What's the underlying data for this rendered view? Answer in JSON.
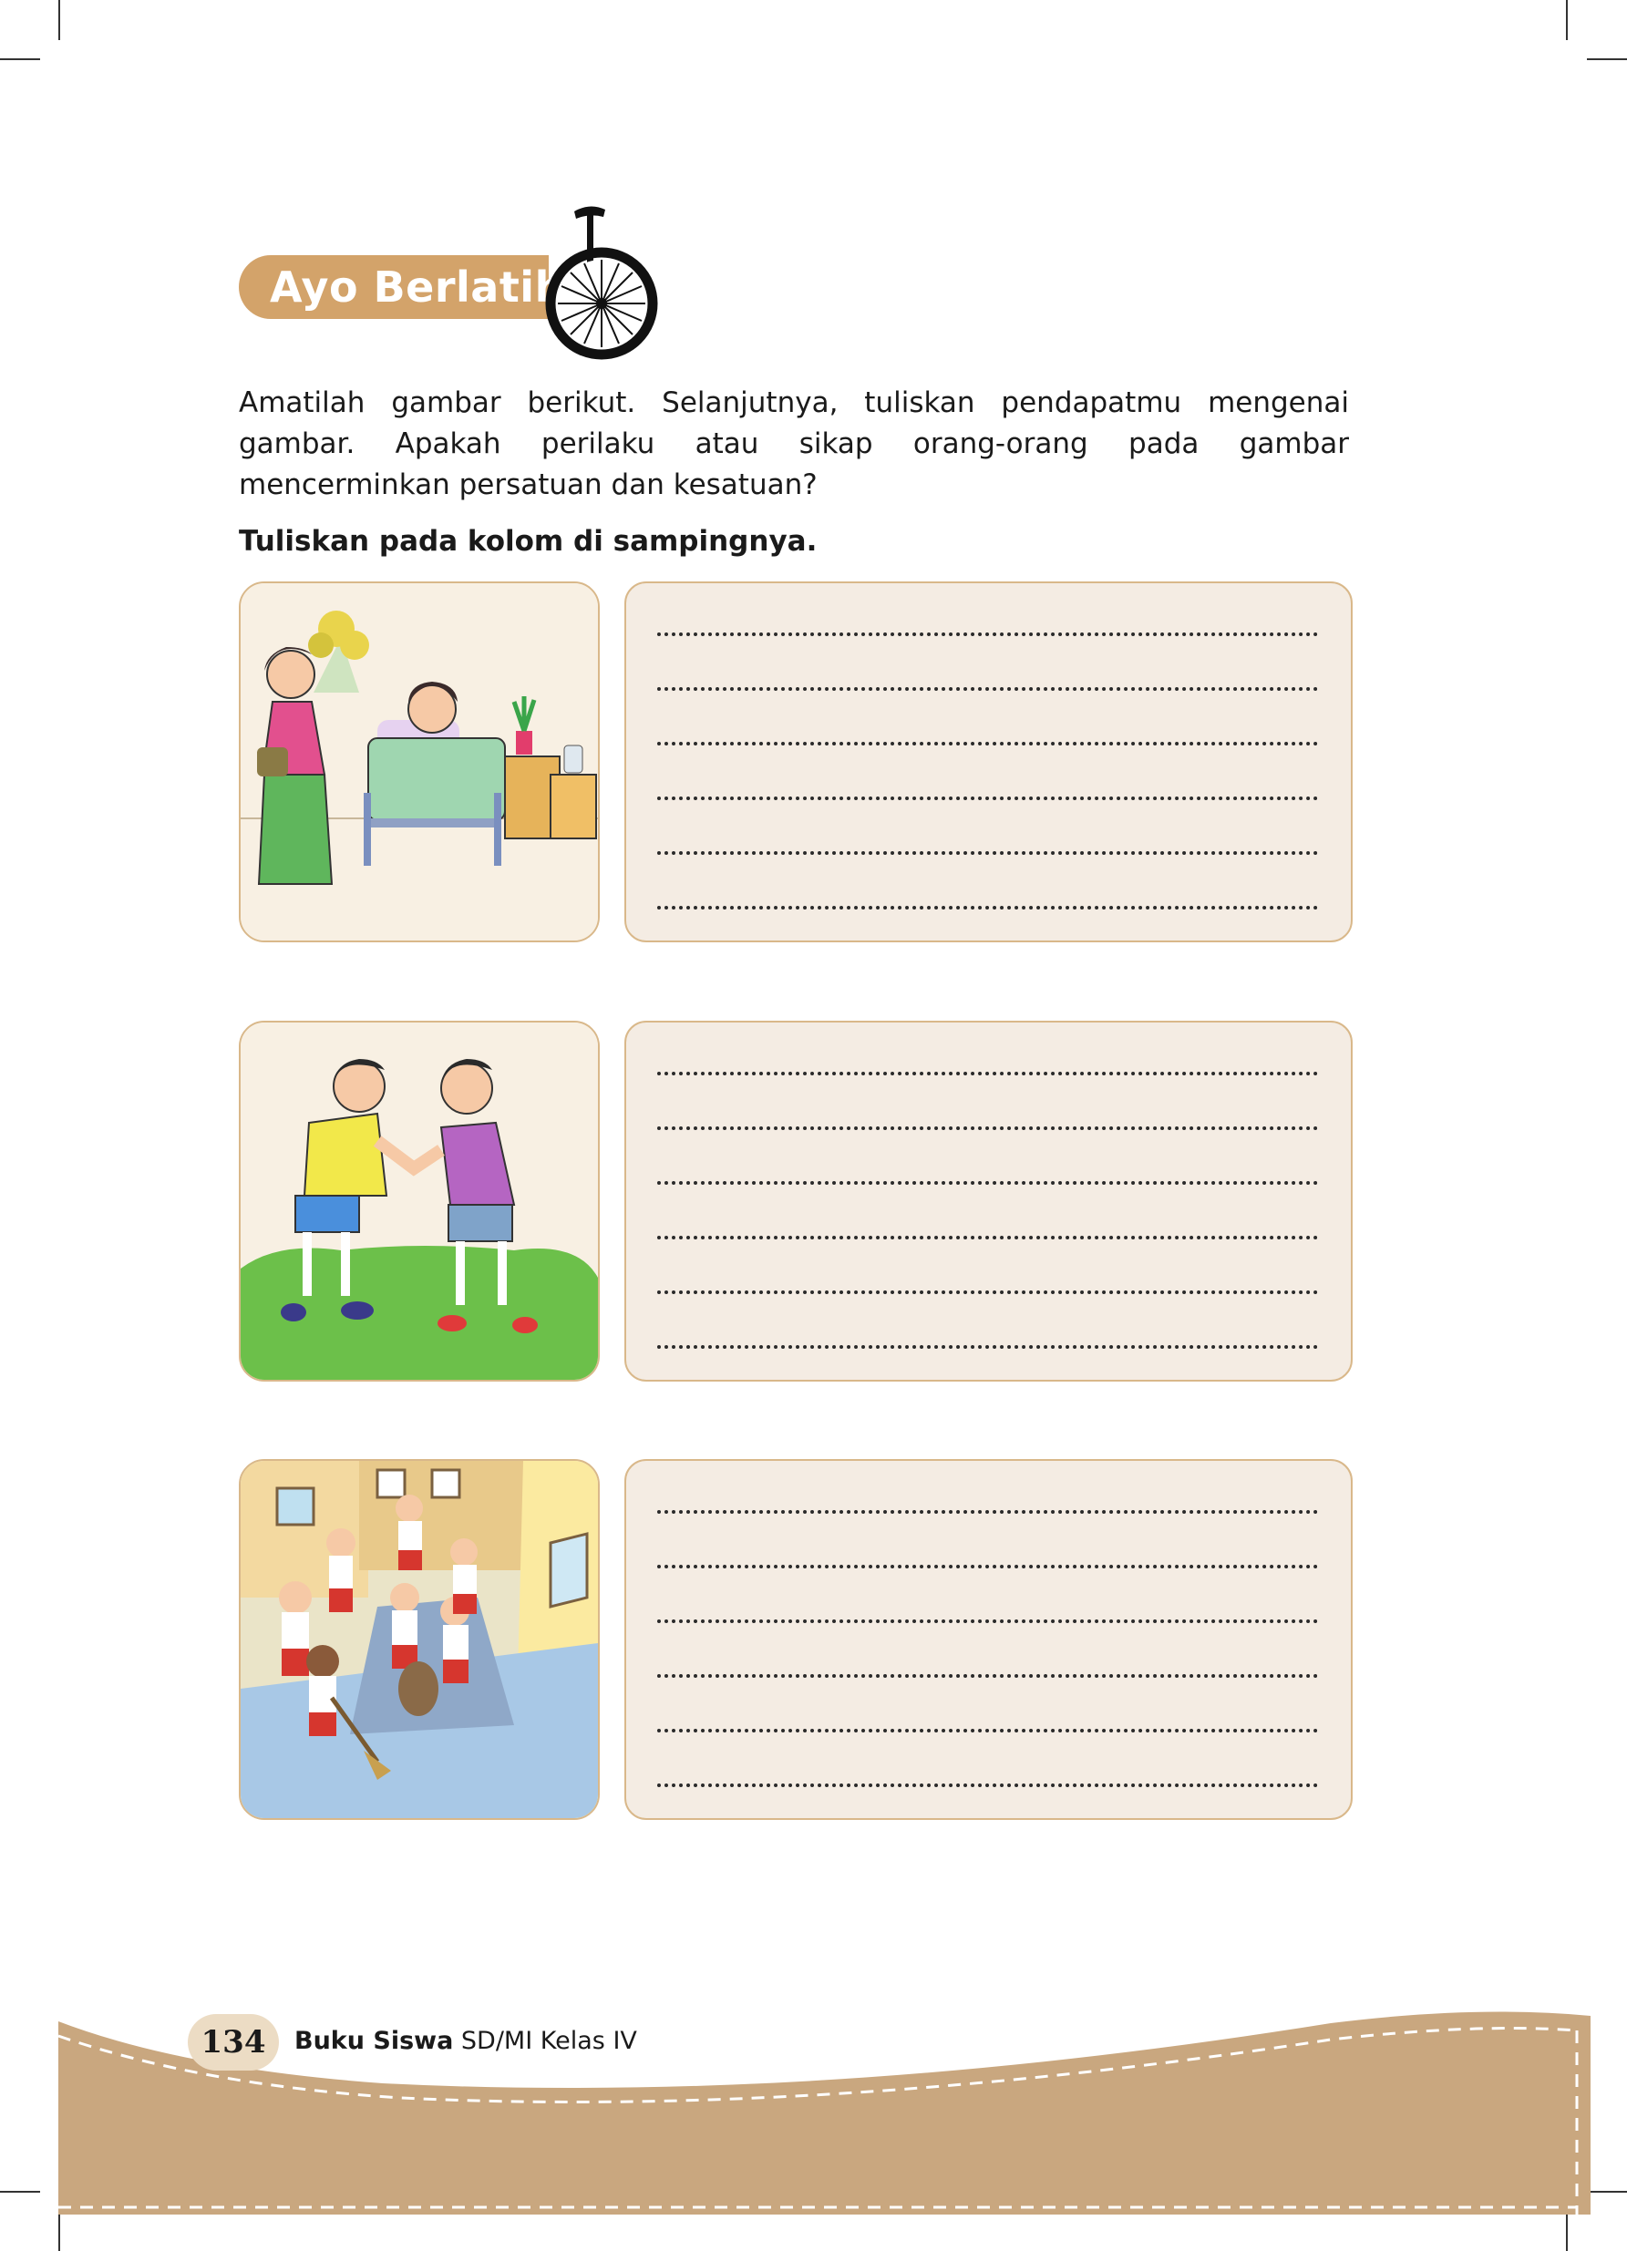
{
  "header": {
    "title": "Ayo Berlatih"
  },
  "intro": {
    "paragraph": "Amatilah gambar berikut. Selanjutnya, tuliskan pendapatmu mengenai gambar. Apakah perilaku atau sikap orang-orang pada gambar mencerminkan persatuan dan kesatuan?",
    "instruction": "Tuliskan pada kolom di sampingnya."
  },
  "exercises": [
    {
      "illustration": "visiting-sick-friend-illustration",
      "lines": 6
    },
    {
      "illustration": "boys-fighting-illustration",
      "lines": 6
    },
    {
      "illustration": "students-cleaning-street-illustration",
      "lines": 6
    }
  ],
  "footer": {
    "page_number": "134",
    "book_title_bold": "Buku Siswa",
    "book_title_rest": " SD/MI Kelas IV"
  },
  "colors": {
    "accent": "#d3a36a",
    "footer": "#c9a77f",
    "answer_bg": "#f4ece3"
  }
}
